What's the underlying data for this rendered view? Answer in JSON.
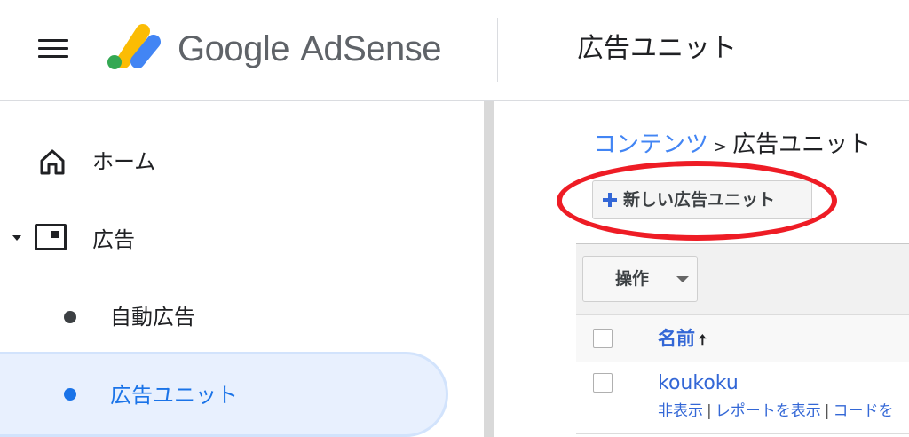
{
  "header": {
    "brand_google": "Google",
    "brand_product": "AdSense",
    "title": "広告ユニット",
    "logo_colors": [
      "#fbbc04",
      "#4285f4",
      "#34a853"
    ]
  },
  "sidebar": {
    "items": [
      {
        "label": "ホーム",
        "icon": "home-icon"
      },
      {
        "label": "広告",
        "icon": "ads-icon",
        "expanded": true
      },
      {
        "label": "自動広告",
        "icon": "bullet-dot"
      },
      {
        "label": "広告ユニット",
        "icon": "bullet-dot",
        "active": true
      }
    ]
  },
  "breadcrumb": {
    "parent": "コンテンツ",
    "separator": ">",
    "current": "広告ユニット"
  },
  "new_button": {
    "label": "新しい広告ユニット",
    "icon": "plus-icon"
  },
  "toolbar": {
    "ops_label": "操作"
  },
  "table": {
    "name_header": "名前",
    "sort_indicator": "🠅",
    "rows": [
      {
        "name": "koukoku",
        "actions": [
          "非表示",
          "レポートを表示",
          "コードを"
        ]
      }
    ]
  },
  "colors": {
    "accent": "#1a73e8",
    "link": "#3367d6",
    "highlight_circle": "#ee1c25",
    "active_bg": "#e8f0fe"
  }
}
